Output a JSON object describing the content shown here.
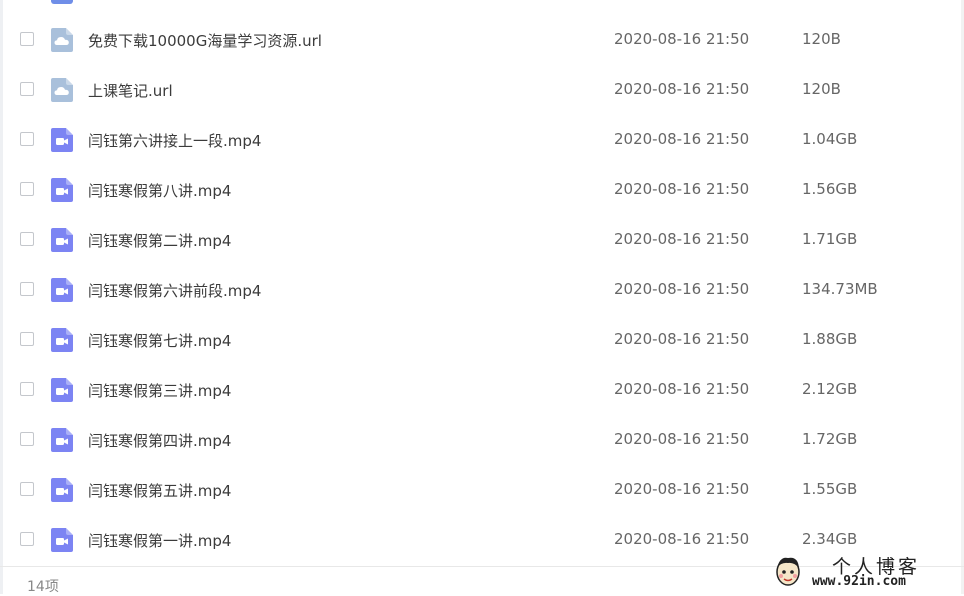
{
  "files": [
    {
      "name": "免费下载10000G海量学习资源.url",
      "date": "2020-08-16 21:50",
      "size": "120B",
      "icon": "url-cloud-icon"
    },
    {
      "name": "上课笔记.url",
      "date": "2020-08-16 21:50",
      "size": "120B",
      "icon": "url-cloud-icon"
    },
    {
      "name": "闫钰第六讲接上一段.mp4",
      "date": "2020-08-16 21:50",
      "size": "1.04GB",
      "icon": "video-file-icon"
    },
    {
      "name": "闫钰寒假第八讲.mp4",
      "date": "2020-08-16 21:50",
      "size": "1.56GB",
      "icon": "video-file-icon"
    },
    {
      "name": "闫钰寒假第二讲.mp4",
      "date": "2020-08-16 21:50",
      "size": "1.71GB",
      "icon": "video-file-icon"
    },
    {
      "name": "闫钰寒假第六讲前段.mp4",
      "date": "2020-08-16 21:50",
      "size": "134.73MB",
      "icon": "video-file-icon"
    },
    {
      "name": "闫钰寒假第七讲.mp4",
      "date": "2020-08-16 21:50",
      "size": "1.88GB",
      "icon": "video-file-icon"
    },
    {
      "name": "闫钰寒假第三讲.mp4",
      "date": "2020-08-16 21:50",
      "size": "2.12GB",
      "icon": "video-file-icon"
    },
    {
      "name": "闫钰寒假第四讲.mp4",
      "date": "2020-08-16 21:50",
      "size": "1.72GB",
      "icon": "video-file-icon"
    },
    {
      "name": "闫钰寒假第五讲.mp4",
      "date": "2020-08-16 21:50",
      "size": "1.55GB",
      "icon": "video-file-icon"
    },
    {
      "name": "闫钰寒假第一讲.mp4",
      "date": "2020-08-16 21:50",
      "size": "2.34GB",
      "icon": "video-file-icon"
    }
  ],
  "footer": {
    "count": "14项"
  },
  "watermark": {
    "title": "个人博客",
    "url": "www.92in.com"
  },
  "colors": {
    "video_icon": "#7c84f3",
    "url_icon": "#a9c0db",
    "checkbox_border": "#c4c7cc"
  }
}
